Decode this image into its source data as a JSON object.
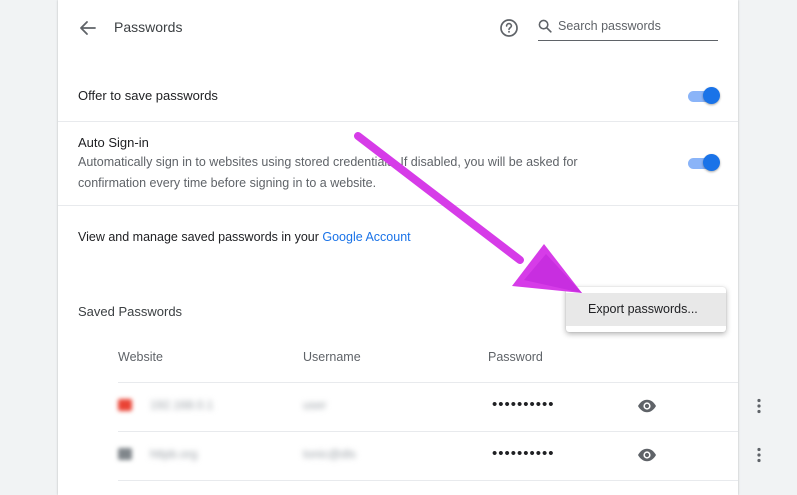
{
  "header": {
    "title": "Passwords",
    "search_placeholder": "Search passwords",
    "back_icon": "arrow-left-icon",
    "help_icon": "help-circle-icon",
    "search_icon": "magnifier-icon"
  },
  "settings": {
    "offer_save": {
      "label": "Offer to save passwords",
      "enabled": true
    },
    "auto_signin": {
      "label": "Auto Sign-in",
      "description_line1": "Automatically sign in to websites using stored credentials. If disabled, you will be asked for",
      "description_line2": "confirmation every time before signing in to a website.",
      "enabled": true
    },
    "manage": {
      "text": "View and manage saved passwords in your ",
      "link": "Google Account"
    }
  },
  "saved_passwords": {
    "title": "Saved Passwords",
    "columns": {
      "website": "Website",
      "username": "Username",
      "password": "Password"
    },
    "rows": [
      {
        "website": "192.168.0.1",
        "username": "user",
        "password": "••••••••••",
        "icon_color": "#ea4335"
      },
      {
        "website": "httpb.org",
        "username": "tonic@dls",
        "password": "••••••••••",
        "icon_color": "#80868b"
      }
    ]
  },
  "menu": {
    "export_label": "Export passwords..."
  },
  "colors": {
    "accent": "#1a73e8",
    "toggle_track": "#8ab4f8",
    "annotation_arrow": "#d63ce8"
  }
}
